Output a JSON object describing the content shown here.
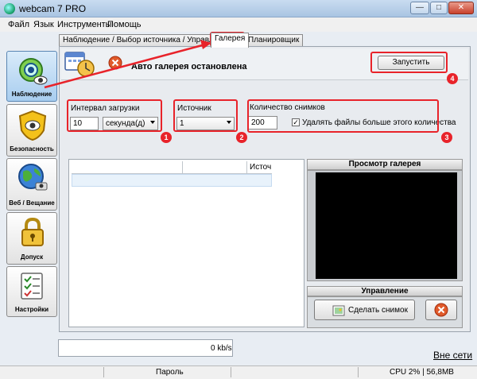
{
  "window": {
    "title": "webcam 7 PRO",
    "minimize": "—",
    "maximize": "□",
    "close": "✕"
  },
  "menu": [
    "Файл",
    "Язык",
    "Инструменты",
    "Помощь"
  ],
  "sidebar": {
    "items": [
      {
        "label": "Наблюдение",
        "icon": "eye-icon",
        "active": true
      },
      {
        "label": "Безопасность",
        "icon": "shield-icon"
      },
      {
        "label": "Веб / Вещание",
        "icon": "globe-icon"
      },
      {
        "label": "Допуск",
        "icon": "lock-icon"
      },
      {
        "label": "Настройки",
        "icon": "checklist-icon"
      }
    ]
  },
  "tabs": [
    {
      "label": "Наблюдение / Выбор источника / Управление"
    },
    {
      "label": "Галерея",
      "active": true
    },
    {
      "label": "Планировщик"
    }
  ],
  "gallery": {
    "status": "Авто галерея остановлена",
    "start_button": "Запустить",
    "interval": {
      "label": "Интервал загрузки",
      "value": "10",
      "unit": "секунда(д)"
    },
    "source": {
      "label": "Источник",
      "value": "1"
    },
    "count": {
      "label": "Количество снимков",
      "value": "200",
      "delete_label": "Удалять файлы больше этого количества",
      "delete_checked": true
    },
    "list": {
      "column": "Источ"
    },
    "preview_title": "Просмотр галерея",
    "control_title": "Управление",
    "snapshot_button": "Сделать снимок"
  },
  "badges": [
    "1",
    "2",
    "3",
    "4"
  ],
  "bottom": {
    "speed": "0 kb/s",
    "offline": "Вне сети"
  },
  "statusbar": {
    "password": "Пароль",
    "cpu": "CPU 2% | 56,8MB"
  },
  "colors": {
    "annotation_red": "#e8232a",
    "active_tab_bg": "#ffffff",
    "preview_bg": "#000000"
  }
}
